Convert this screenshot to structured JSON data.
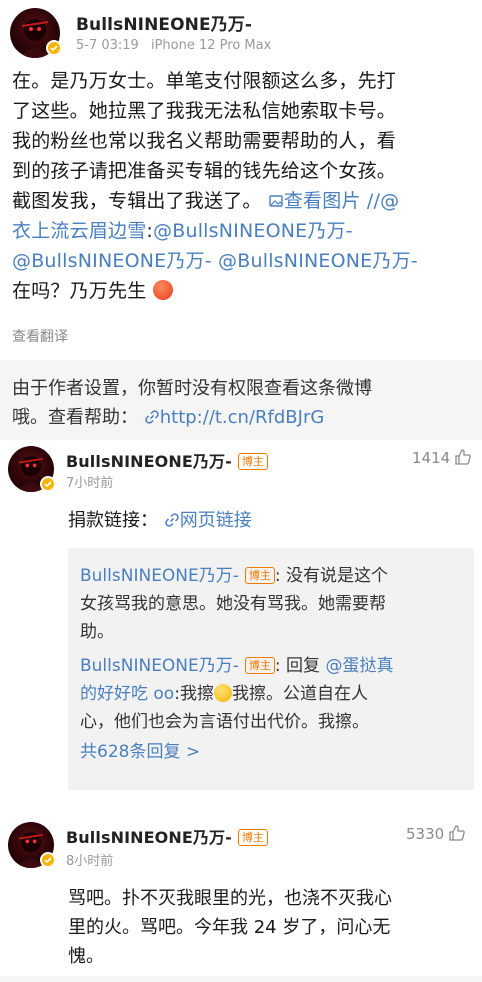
{
  "post": {
    "author": "BullsNINEONE乃万-",
    "time": "5-7 03:19",
    "device": "iPhone 12 Pro Max",
    "lines": [
      "在。是乃万女士。单笔支付限额这么多，先打",
      "了这些。她拉黑了我我无法私信她索取卡号。",
      "我的粉丝也常以我名义帮助需要帮助的人，看",
      "到的孩子请把准备买专辑的钱先给这个女孩。"
    ],
    "line5_text": "截图发我，专辑出了我送了。",
    "view_image_label": "查看图片",
    "line5_tail": "//@",
    "line6_mention": "衣上流云眉边雪",
    "line6_colon": ":",
    "line6_mention2": "@BullsNINEONE乃万-",
    "line7_mention1": "@BullsNINEONE乃万-",
    "line7_mention2": "@BullsNINEONE乃万-",
    "line8_text": "在吗？乃万先生",
    "translate_label": "查看翻译"
  },
  "notice": {
    "line1": "由于作者设置，你暂时没有权限查看这条微博",
    "line2_prefix": "哦。查看帮助：",
    "link": "http://t.cn/RfdBJrG"
  },
  "comments": [
    {
      "author": "BullsNINEONE乃万-",
      "badge": "博主",
      "time": "7小时前",
      "likes": "1414",
      "text_prefix": "捐款链接：",
      "link_label": "网页链接",
      "replies": {
        "r1_author": "BullsNINEONE乃万-",
        "r1_badge": "博主",
        "r1_line1": ": 没有说是这个",
        "r1_line2": "女孩骂我的意思。她没有骂我。她需要帮",
        "r1_line3": "助。",
        "r2_author": "BullsNINEONE乃万-",
        "r2_badge": "博主",
        "r2_line1_prefix": ": 回复",
        "r2_line1_mention": "@蛋挞真",
        "r2_line2_mention": "的好好吃 oo",
        "r2_line2_a": ":我擦",
        "r2_line2_b": "我擦。公道自在人",
        "r2_line3": "心，他们也会为言语付出代价。我擦。",
        "more_label": "共628条回复 >"
      }
    },
    {
      "author": "BullsNINEONE乃万-",
      "badge": "博主",
      "time": "8小时前",
      "likes": "5330",
      "lines": [
        "骂吧。扑不灭我眼里的光，也浇不灭我心",
        "里的火。骂吧。今年我 24 岁了，问心无",
        "愧。"
      ]
    }
  ],
  "colors": {
    "link": "#4a7fbf",
    "badge": "#f07a00",
    "verified": "#f5b400"
  }
}
